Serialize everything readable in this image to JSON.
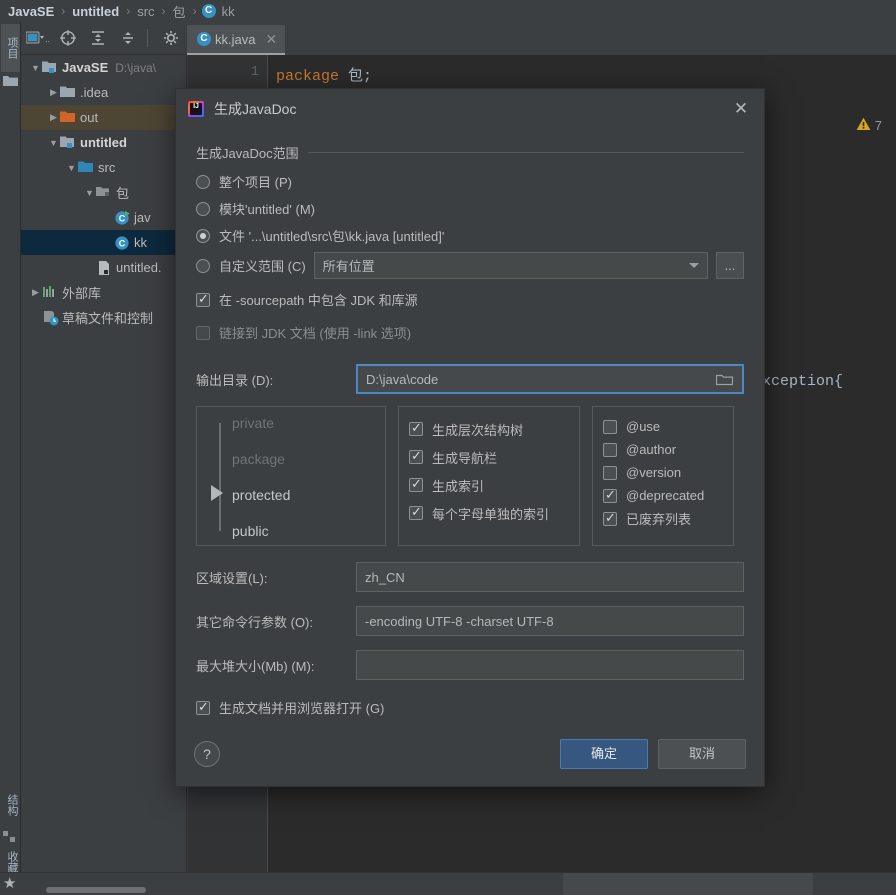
{
  "navbar": {
    "crumbs": [
      "JavaSE",
      "untitled",
      "src",
      "包",
      "kk"
    ],
    "separator": "›",
    "class_badge": "C"
  },
  "toolbar": {
    "buttons": [
      "run-config-selector",
      "build-project-icon",
      "expand-all-icon",
      "collapse-all-icon",
      "settings-icon"
    ]
  },
  "editor_tab": {
    "label": "kk.java",
    "badge": "C",
    "close": "✕"
  },
  "project_tree": {
    "items": [
      {
        "indent": 0,
        "arrow": "v",
        "icon": "module-folder",
        "label": "JavaSE",
        "bold": true,
        "path": "D:\\java\\",
        "state": "normal"
      },
      {
        "indent": 1,
        "arrow": ">",
        "icon": "folder",
        "label": ".idea",
        "bold": false,
        "path": "",
        "state": "normal"
      },
      {
        "indent": 1,
        "arrow": ">",
        "icon": "folder-orange",
        "label": "out",
        "bold": false,
        "path": "",
        "state": "highlight-out"
      },
      {
        "indent": 1,
        "arrow": "v",
        "icon": "module-folder",
        "label": "untitled",
        "bold": true,
        "path": "",
        "state": "normal"
      },
      {
        "indent": 2,
        "arrow": "v",
        "icon": "folder-src",
        "label": "src",
        "bold": false,
        "path": "",
        "state": "normal"
      },
      {
        "indent": 3,
        "arrow": "v",
        "icon": "package",
        "label": "包",
        "bold": false,
        "path": "",
        "state": "normal"
      },
      {
        "indent": 4,
        "arrow": "",
        "icon": "class-run",
        "label": "jav",
        "bold": false,
        "path": "",
        "state": "normal"
      },
      {
        "indent": 4,
        "arrow": "",
        "icon": "class",
        "label": "kk",
        "bold": false,
        "path": "",
        "state": "selected"
      },
      {
        "indent": 3,
        "arrow": "",
        "icon": "iml-file",
        "label": "untitled.",
        "bold": false,
        "path": "",
        "state": "normal"
      },
      {
        "indent": 0,
        "arrow": ">",
        "icon": "library",
        "label": "外部库",
        "bold": false,
        "path": "",
        "state": "normal"
      },
      {
        "indent": 0,
        "arrow": "",
        "icon": "scratch",
        "label": "草稿文件和控制",
        "bold": false,
        "path": "",
        "state": "normal"
      }
    ]
  },
  "left_strip": {
    "tabs": [
      {
        "name": "project-tab",
        "label": "项目",
        "selected": true
      },
      {
        "name": "structure-tab",
        "label": "结构",
        "selected": false
      },
      {
        "name": "favorites-tab",
        "label": "收藏夹",
        "selected": false
      }
    ]
  },
  "editor": {
    "line_number": "1",
    "code_keyword": "package",
    "code_rest": " 包;",
    "occluded_fragment": "xception{",
    "inspection_icon": "warning-triangle-icon",
    "inspection_count": "7"
  },
  "dialog": {
    "title": "生成JavaDoc",
    "close_label": "✕",
    "icon_text": "IJ",
    "scope_group_label": "生成JavaDoc范围",
    "radios": [
      {
        "label": "整个项目 (P)",
        "selected": false
      },
      {
        "label": "模块'untitled' (M)",
        "selected": false
      },
      {
        "label": "文件 '...\\untitled\\src\\包\\kk.java [untitled]'",
        "selected": true
      },
      {
        "label": "自定义范围 (C)",
        "selected": false
      }
    ],
    "custom_scope_value": "所有位置",
    "ellipsis_button": "...",
    "sourcepath_check": {
      "label": "在 -sourcepath 中包含 JDK 和库源",
      "checked": true,
      "disabled": false
    },
    "jdk_link_check": {
      "label": "链接到 JDK 文档 (使用 -link 选项)",
      "checked": false,
      "disabled": true
    },
    "output_dir": {
      "label": "输出目录 (D):",
      "value": "D:\\java\\code",
      "browse_icon": "folder-browse-icon"
    },
    "visibility": {
      "items": [
        {
          "label": "private",
          "active": false
        },
        {
          "label": "package",
          "active": false
        },
        {
          "label": "protected",
          "active": true
        },
        {
          "label": "public",
          "active": true
        }
      ],
      "selected": "protected"
    },
    "generate_options": [
      {
        "label": "生成层次结构树",
        "checked": true
      },
      {
        "label": "生成导航栏",
        "checked": true
      },
      {
        "label": "生成索引",
        "checked": true
      },
      {
        "label": "每个字母单独的索引",
        "checked": true
      }
    ],
    "tag_options": [
      {
        "label": "@use",
        "checked": false
      },
      {
        "label": "@author",
        "checked": false
      },
      {
        "label": "@version",
        "checked": false
      },
      {
        "label": "@deprecated",
        "checked": true
      },
      {
        "label": "已废弃列表",
        "checked": true
      }
    ],
    "locale": {
      "label": "区域设置(L):",
      "value": "zh_CN"
    },
    "other_args": {
      "label": "其它命令行参数 (O):",
      "value": "-encoding UTF-8 -charset UTF-8"
    },
    "max_heap": {
      "label": "最大堆大小(Mb) (M):",
      "value": ""
    },
    "open_in_browser": {
      "label": "生成文档并用浏览器打开 (G)",
      "checked": true
    },
    "help_button": "?",
    "ok_button": "确定",
    "cancel_button": "取消"
  },
  "colors": {
    "accent": "#4a88c7",
    "primary_button": "#365880",
    "bg": "#3c3f41",
    "editor_bg": "#2b2b2b",
    "keyword": "#cc7832",
    "selection": "#0d293e",
    "out_folder_highlight": "#4e4634",
    "warning": "#d9a520"
  }
}
